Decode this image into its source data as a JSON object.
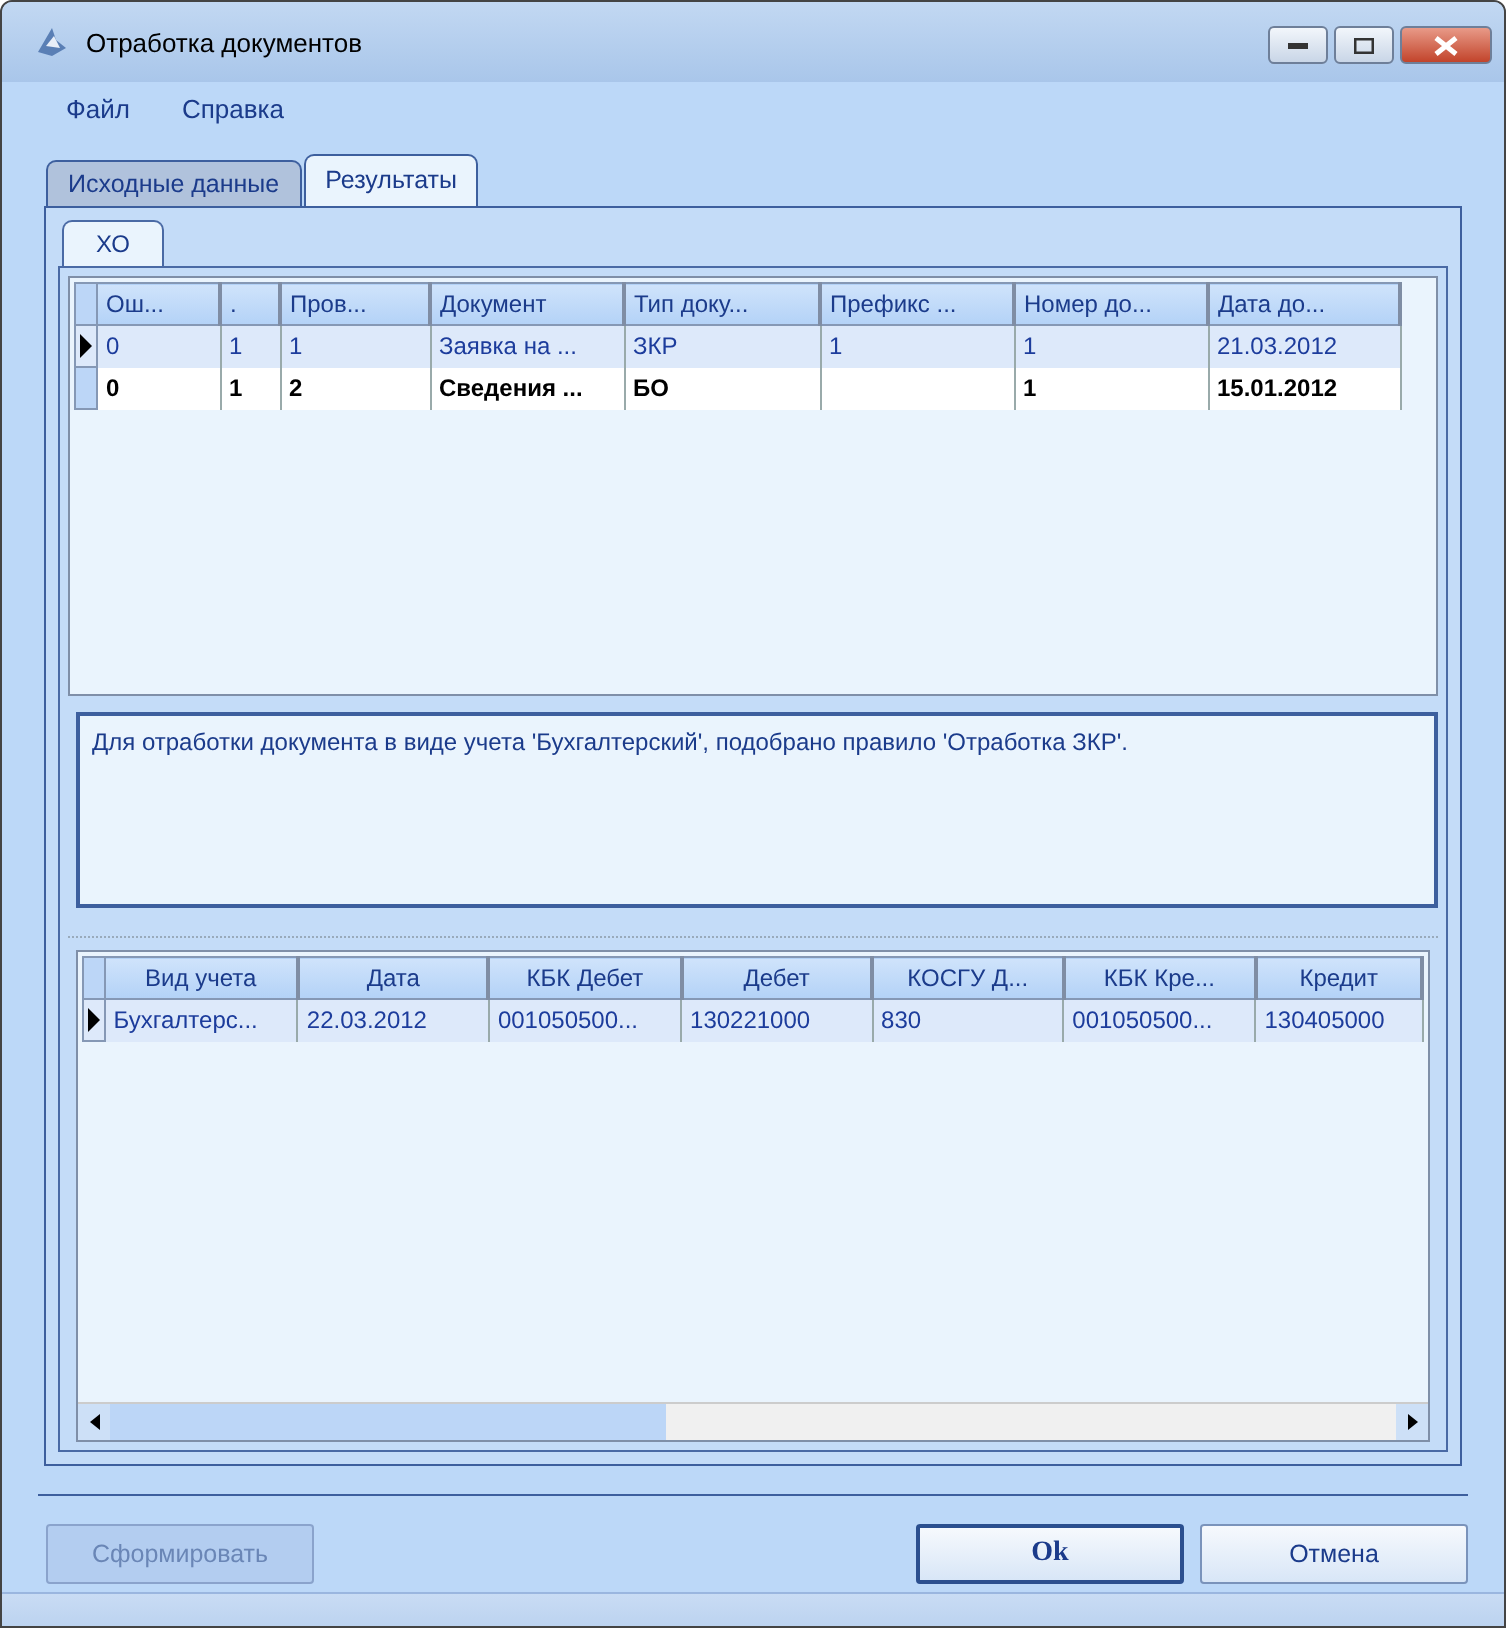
{
  "window": {
    "title": "Отработка документов"
  },
  "menu": [
    {
      "label": "Файл"
    },
    {
      "label": "Справка"
    }
  ],
  "tabs": [
    {
      "label": "Исходные данные",
      "selected": false
    },
    {
      "label": "Результаты",
      "selected": true
    }
  ],
  "subtabs": [
    {
      "label": "ХО",
      "selected": true
    }
  ],
  "documents_grid": {
    "columns": [
      "Ош...",
      ".",
      "Пров...",
      "Документ",
      "Тип доку...",
      "Префикс ...",
      "Номер до...",
      "Дата до..."
    ],
    "rows": [
      {
        "selected": true,
        "bold": false,
        "cells": [
          "0",
          "1",
          "1",
          "Заявка на ...",
          "ЗКР",
          "1",
          "1",
          "21.03.2012"
        ]
      },
      {
        "selected": false,
        "bold": true,
        "cells": [
          "0",
          "1",
          "2",
          "Сведения ...",
          "БО",
          "",
          "1",
          "15.01.2012"
        ]
      }
    ]
  },
  "message": "Для отработки документа в виде учета 'Бухгалтерский', подобрано правило 'Отработка ЗКР'.",
  "entries_grid": {
    "columns": [
      "Вид учета",
      "Дата",
      "КБК Дебет",
      "Дебет",
      "КОСГУ Д...",
      "КБК Кре...",
      "Кредит"
    ],
    "rows": [
      {
        "selected": true,
        "bold": false,
        "cells": [
          "Бухгалтерс...",
          "22.03.2012",
          "001050500...",
          "130221000",
          "830",
          "001050500...",
          "130405000"
        ]
      }
    ]
  },
  "buttons": [
    {
      "label": "Сформировать",
      "disabled": true,
      "default": false
    },
    {
      "label": "Ok",
      "disabled": false,
      "default": true
    },
    {
      "label": "Отмена",
      "disabled": false,
      "default": false
    }
  ]
}
